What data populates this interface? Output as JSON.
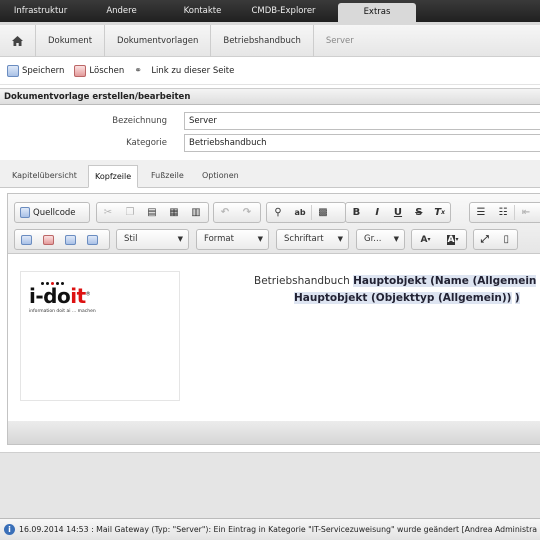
{
  "topnav": {
    "items": [
      "Infrastruktur",
      "Andere",
      "Kontakte",
      "CMDB-Explorer",
      "Extras"
    ],
    "active_index": 4
  },
  "breadcrumb": [
    "Dokument",
    "Dokumentvorlagen",
    "Betriebshandbuch",
    "Server"
  ],
  "toolbar": {
    "save_label": "Speichern",
    "delete_label": "Löschen",
    "link_label": "Link zu dieser Seite"
  },
  "form": {
    "heading": "Dokumentvorlage erstellen/bearbeiten",
    "bezeichnung_label": "Bezeichnung",
    "bezeichnung_value": "Server",
    "kategorie_label": "Kategorie",
    "kategorie_value": "Betriebshandbuch"
  },
  "tabs": [
    "Kapitelübersicht",
    "Kopfzeile",
    "Fußzeile",
    "Optionen"
  ],
  "active_tab": 1,
  "editor": {
    "source_label": "Quellcode",
    "style_combo": "Stil",
    "format_combo": "Format",
    "font_combo": "Schriftart",
    "size_combo": "Gr...",
    "header_text_plain": "Betriebshandbuch",
    "placeholder_1": "Hauptobjekt (Name (Allgemein",
    "placeholder_2": "Hauptobjekt (Objekttyp (Allgemein))",
    "placeholder_2_suffix": ")",
    "logo": {
      "brand_left": "i-do",
      "brand_right": "it",
      "trademark": "®",
      "tagline": "information doit ai ... machen"
    }
  },
  "status": {
    "icon": "info-icon",
    "text": "16.09.2014 14:53 : Mail Gateway (Typ: \"Server\"): Ein Eintrag in Kategorie \"IT-Servicezuweisung\" wurde geändert [Andrea Administra"
  },
  "colors": {
    "nav_bg": "#2a2a2a",
    "active_tab_bg": "#d9d9d9",
    "placeholder_bg": "#dde4f1",
    "logo_accent": "#dd1111"
  }
}
